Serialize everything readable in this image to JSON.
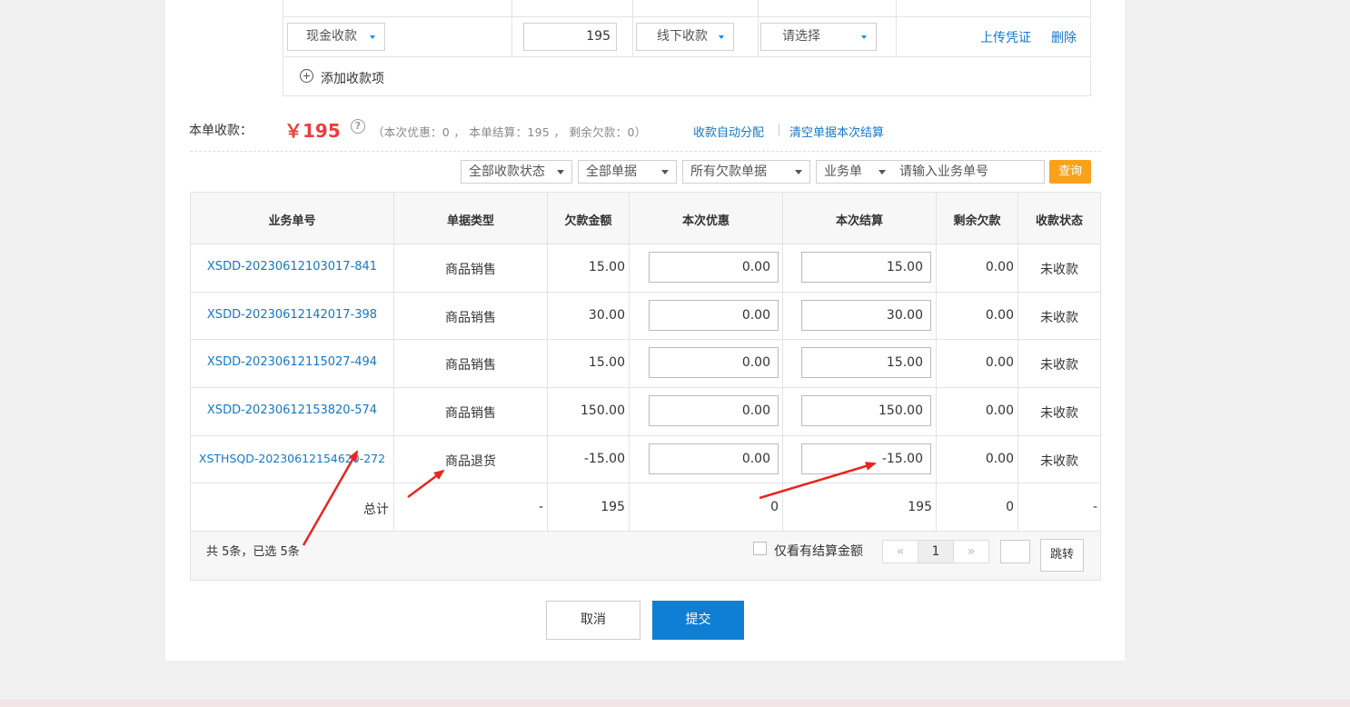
{
  "payment_row": {
    "method": "现金收款",
    "amount": "195",
    "channel": "线下收款",
    "account_placeholder": "请选择",
    "upload_label": "上传凭证",
    "delete_label": "删除"
  },
  "add_item_label": "添加收款项",
  "summary": {
    "label": "本单收款：",
    "amount": "￥195",
    "help_icon": "?",
    "detail": "（本次优惠：0 ， 本单结算：195 ， 剩余欠款：0）",
    "auto_allocate": "收款自动分配",
    "clear_settlement": "清空单据本次结算"
  },
  "filters": {
    "status": "全部收款状态",
    "doc_type": "全部单据",
    "debt": "所有欠款单据",
    "search_field": "业务单",
    "search_placeholder": "请输入业务单号",
    "query": "查询"
  },
  "table": {
    "headers": [
      "业务单号",
      "单据类型",
      "欠款金额",
      "本次优惠",
      "本次结算",
      "剩余欠款",
      "收款状态"
    ],
    "rows": [
      {
        "order_no": "XSDD-20230612103017-841",
        "type": "商品销售",
        "debt": "15.00",
        "discount": "0.00",
        "settle": "15.00",
        "remaining": "0.00",
        "status": "未收款"
      },
      {
        "order_no": "XSDD-20230612142017-398",
        "type": "商品销售",
        "debt": "30.00",
        "discount": "0.00",
        "settle": "30.00",
        "remaining": "0.00",
        "status": "未收款"
      },
      {
        "order_no": "XSDD-20230612115027-494",
        "type": "商品销售",
        "debt": "15.00",
        "discount": "0.00",
        "settle": "15.00",
        "remaining": "0.00",
        "status": "未收款"
      },
      {
        "order_no": "XSDD-20230612153820-574",
        "type": "商品销售",
        "debt": "150.00",
        "discount": "0.00",
        "settle": "150.00",
        "remaining": "0.00",
        "status": "未收款"
      },
      {
        "order_no": "XSTHSQD-20230612154620-272",
        "type": "商品退货",
        "debt": "-15.00",
        "discount": "0.00",
        "settle": "-15.00",
        "remaining": "0.00",
        "status": "未收款"
      }
    ],
    "total": {
      "label": "总计",
      "type": "-",
      "debt": "195",
      "discount": "0",
      "settle": "195",
      "remaining": "0",
      "status": "-"
    }
  },
  "footer": {
    "count_text": "共 5条，已选 5条",
    "only_settled_label": "仅看有结算金额",
    "prev": "«",
    "page": "1",
    "next": "»",
    "jump": "跳转"
  },
  "actions": {
    "cancel": "取消",
    "submit": "提交"
  },
  "colors": {
    "link": "#1478c9",
    "amount": "#ee3c3c",
    "query_button": "#f8a21b",
    "submit_button": "#0f7fd6",
    "annotation_arrow": "#e8251e"
  }
}
